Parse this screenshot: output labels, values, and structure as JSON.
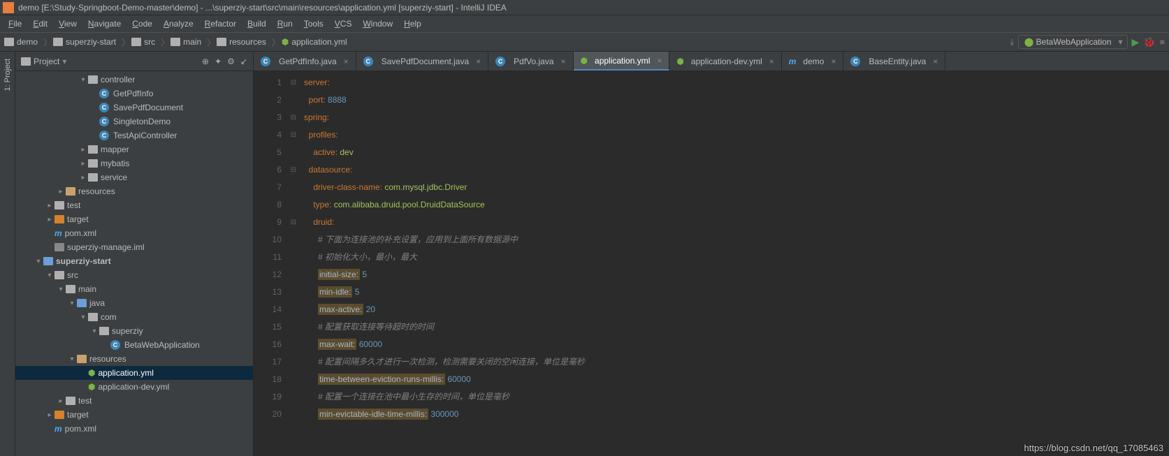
{
  "title": "demo [E:\\Study-Springboot-Demo-master\\demo] - ...\\superziy-start\\src\\main\\resources\\application.yml [superziy-start] - IntelliJ IDEA",
  "menu": [
    "File",
    "Edit",
    "View",
    "Navigate",
    "Code",
    "Analyze",
    "Refactor",
    "Build",
    "Run",
    "Tools",
    "VCS",
    "Window",
    "Help"
  ],
  "breadcrumbs": [
    "demo",
    "superziy-start",
    "src",
    "main",
    "resources",
    "application.yml"
  ],
  "run_config": "BetaWebApplication",
  "sidebar": {
    "title": "Project",
    "tools": [
      "⊕",
      "✦",
      "⚙",
      "↙"
    ],
    "items": [
      {
        "indent": 4,
        "arrow": "▾",
        "icon": "folder",
        "label": "controller"
      },
      {
        "indent": 5,
        "arrow": "",
        "icon": "class",
        "label": "GetPdfInfo"
      },
      {
        "indent": 5,
        "arrow": "",
        "icon": "class",
        "label": "SavePdfDocument"
      },
      {
        "indent": 5,
        "arrow": "",
        "icon": "class",
        "label": "SingletonDemo"
      },
      {
        "indent": 5,
        "arrow": "",
        "icon": "class",
        "label": "TestApiController"
      },
      {
        "indent": 4,
        "arrow": "▸",
        "icon": "folder",
        "label": "mapper"
      },
      {
        "indent": 4,
        "arrow": "▸",
        "icon": "folder",
        "label": "mybatis"
      },
      {
        "indent": 4,
        "arrow": "▸",
        "icon": "folder",
        "label": "service"
      },
      {
        "indent": 2,
        "arrow": "▸",
        "icon": "rfolder",
        "label": "resources"
      },
      {
        "indent": 1,
        "arrow": "▸",
        "icon": "folder",
        "label": "test"
      },
      {
        "indent": 1,
        "arrow": "▸",
        "icon": "ofolder",
        "label": "target"
      },
      {
        "indent": 1,
        "arrow": "",
        "icon": "m",
        "label": "pom.xml"
      },
      {
        "indent": 1,
        "arrow": "",
        "icon": "file",
        "label": "superziy-manage.iml"
      },
      {
        "indent": 0,
        "arrow": "▾",
        "icon": "bfolder",
        "label": "superziy-start",
        "bold": true
      },
      {
        "indent": 1,
        "arrow": "▾",
        "icon": "folder",
        "label": "src"
      },
      {
        "indent": 2,
        "arrow": "▾",
        "icon": "folder",
        "label": "main"
      },
      {
        "indent": 3,
        "arrow": "▾",
        "icon": "bfolder",
        "label": "java"
      },
      {
        "indent": 4,
        "arrow": "▾",
        "icon": "folder",
        "label": "com"
      },
      {
        "indent": 5,
        "arrow": "▾",
        "icon": "folder",
        "label": "superziy"
      },
      {
        "indent": 6,
        "arrow": "",
        "icon": "class",
        "label": "BetaWebApplication"
      },
      {
        "indent": 3,
        "arrow": "▾",
        "icon": "rfolder",
        "label": "resources"
      },
      {
        "indent": 4,
        "arrow": "",
        "icon": "yml",
        "label": "application.yml",
        "sel": true
      },
      {
        "indent": 4,
        "arrow": "",
        "icon": "yml",
        "label": "application-dev.yml"
      },
      {
        "indent": 2,
        "arrow": "▸",
        "icon": "folder",
        "label": "test"
      },
      {
        "indent": 1,
        "arrow": "▸",
        "icon": "ofolder",
        "label": "target"
      },
      {
        "indent": 1,
        "arrow": "",
        "icon": "m",
        "label": "pom.xml"
      }
    ]
  },
  "tabs": [
    {
      "icon": "class",
      "label": "GetPdfInfo.java"
    },
    {
      "icon": "class",
      "label": "SavePdfDocument.java"
    },
    {
      "icon": "class",
      "label": "PdfVo.java"
    },
    {
      "icon": "yml",
      "label": "application.yml",
      "active": true
    },
    {
      "icon": "yml",
      "label": "application-dev.yml"
    },
    {
      "icon": "m",
      "label": "demo"
    },
    {
      "icon": "class",
      "label": "BaseEntity.java"
    }
  ],
  "code": {
    "first_line": 1,
    "lines": [
      [
        [
          "k",
          "server:"
        ]
      ],
      [
        [
          "plain",
          "  "
        ],
        [
          "k",
          "port: "
        ],
        [
          "num",
          "8888"
        ]
      ],
      [
        [
          "k",
          "spring:"
        ]
      ],
      [
        [
          "plain",
          "  "
        ],
        [
          "k",
          "profiles:"
        ]
      ],
      [
        [
          "plain",
          "    "
        ],
        [
          "k",
          "active: "
        ],
        [
          "s",
          "dev"
        ]
      ],
      [
        [
          "plain",
          "  "
        ],
        [
          "k",
          "datasource:"
        ]
      ],
      [
        [
          "plain",
          "    "
        ],
        [
          "k",
          "driver-class-name: "
        ],
        [
          "s",
          "com.mysql.jdbc.Driver"
        ]
      ],
      [
        [
          "plain",
          "    "
        ],
        [
          "k",
          "type: "
        ],
        [
          "s",
          "com.alibaba.druid.pool.DruidDataSource"
        ]
      ],
      [
        [
          "plain",
          "    "
        ],
        [
          "k",
          "druid:"
        ]
      ],
      [
        [
          "plain",
          "      "
        ],
        [
          "c",
          "# 下面为连接池的补充设置，应用到上面所有数据源中"
        ]
      ],
      [
        [
          "plain",
          "      "
        ],
        [
          "c",
          "# 初始化大小，最小，最大"
        ]
      ],
      [
        [
          "plain",
          "      "
        ],
        [
          "hl",
          "initial-size:"
        ],
        [
          "plain",
          " "
        ],
        [
          "num",
          "5"
        ]
      ],
      [
        [
          "plain",
          "      "
        ],
        [
          "hl",
          "min-idle:"
        ],
        [
          "plain",
          " "
        ],
        [
          "num",
          "5"
        ]
      ],
      [
        [
          "plain",
          "      "
        ],
        [
          "hl",
          "max-active:"
        ],
        [
          "plain",
          " "
        ],
        [
          "num",
          "20"
        ]
      ],
      [
        [
          "plain",
          "      "
        ],
        [
          "c",
          "# 配置获取连接等待超时的时间"
        ]
      ],
      [
        [
          "plain",
          "      "
        ],
        [
          "hl",
          "max-wait:"
        ],
        [
          "plain",
          " "
        ],
        [
          "num",
          "60000"
        ]
      ],
      [
        [
          "plain",
          "      "
        ],
        [
          "c",
          "# 配置间隔多久才进行一次检测，检测需要关闭的空闲连接，单位是毫秒"
        ]
      ],
      [
        [
          "plain",
          "      "
        ],
        [
          "hl",
          "time-between-eviction-runs-millis:"
        ],
        [
          "plain",
          " "
        ],
        [
          "num",
          "60000"
        ]
      ],
      [
        [
          "plain",
          "      "
        ],
        [
          "c",
          "# 配置一个连接在池中最小生存的时间，单位是毫秒"
        ]
      ],
      [
        [
          "plain",
          "      "
        ],
        [
          "hl",
          "min-evictable-idle-time-millis:"
        ],
        [
          "plain",
          " "
        ],
        [
          "num",
          "300000"
        ]
      ]
    ],
    "fold": {
      "1": "⊟",
      "3": "⊟",
      "4": "⊟",
      "6": "⊟",
      "9": "⊟"
    }
  },
  "vtab": "1: Project",
  "watermark": "https://blog.csdn.net/qq_17085463"
}
